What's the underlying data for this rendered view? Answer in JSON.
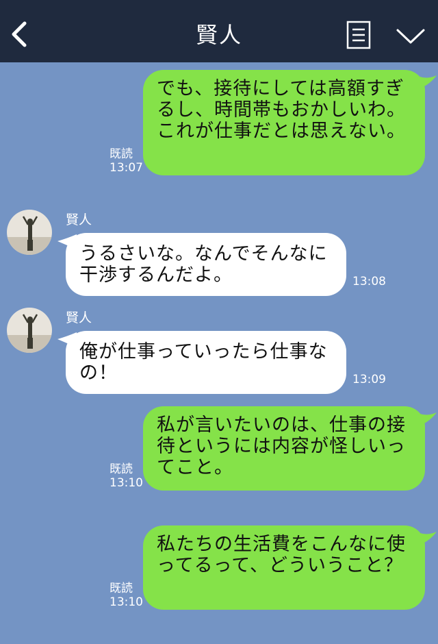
{
  "header": {
    "title": "賢人"
  },
  "read_label": "既読",
  "messages": [
    {
      "direction": "out",
      "text": "でも、接待にしては高額すぎるし、時間帯もおかしいわ。これが仕事だとは思えない。",
      "time": "13:07"
    },
    {
      "direction": "in",
      "sender": "賢人",
      "text": "うるさいな。なんでそんなに干渉するんだよ。",
      "time": "13:08"
    },
    {
      "direction": "in",
      "sender": "賢人",
      "text": "俺が仕事っていったら仕事なの！",
      "time": "13:09"
    },
    {
      "direction": "out",
      "text": "私が言いたいのは、仕事の接待というには内容が怪しいってこと。",
      "time": "13:10"
    },
    {
      "direction": "out",
      "text": "私たちの生活費をこんなに使ってるって、どういうこと？",
      "time": "13:10"
    }
  ],
  "icons": {
    "back": "chevron-left-icon",
    "menu": "notes-menu-icon",
    "expand": "chevron-down-icon"
  },
  "colors": {
    "header": "#1f2a3e",
    "background": "#7494c4",
    "outgoing_bubble": "#85e249",
    "incoming_bubble": "#ffffff"
  }
}
